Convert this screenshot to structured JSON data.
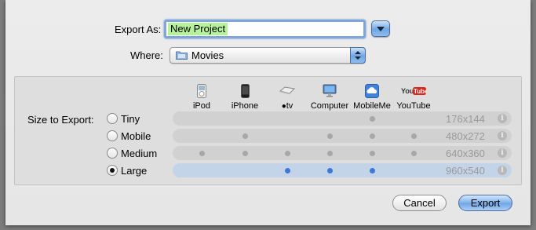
{
  "export_as": {
    "label": "Export As:",
    "value": "New Project"
  },
  "where": {
    "label": "Where:",
    "value": "Movies"
  },
  "size_section": {
    "label": "Size to Export:",
    "devices": [
      {
        "name": "iPod",
        "icon": "ipod-icon"
      },
      {
        "name": "iPhone",
        "icon": "iphone-icon"
      },
      {
        "name": "tv",
        "icon": "apple-tv-icon"
      },
      {
        "name": "Computer",
        "icon": "computer-icon"
      },
      {
        "name": "MobileMe",
        "icon": "mobileme-icon"
      },
      {
        "name": "YouTube",
        "icon": "youtube-icon"
      }
    ],
    "sizes": [
      {
        "name": "Tiny",
        "resolution": "176x144",
        "selected": false,
        "devices": [
          0,
          0,
          0,
          0,
          1,
          0
        ]
      },
      {
        "name": "Mobile",
        "resolution": "480x272",
        "selected": false,
        "devices": [
          0,
          1,
          0,
          1,
          1,
          1
        ]
      },
      {
        "name": "Medium",
        "resolution": "640x360",
        "selected": false,
        "devices": [
          1,
          1,
          1,
          1,
          1,
          1
        ]
      },
      {
        "name": "Large",
        "resolution": "960x540",
        "selected": true,
        "devices": [
          0,
          0,
          1,
          1,
          1,
          0
        ]
      }
    ],
    "info_glyph": "i"
  },
  "buttons": {
    "cancel": "Cancel",
    "export": "Export"
  },
  "colors": {
    "selected_row": "#c3d4e8",
    "highlight": "#b6f29a",
    "active_dot": "#3f77d8",
    "inactive_dot": "#a7a7a7",
    "youtube_red": "#d9261c"
  }
}
